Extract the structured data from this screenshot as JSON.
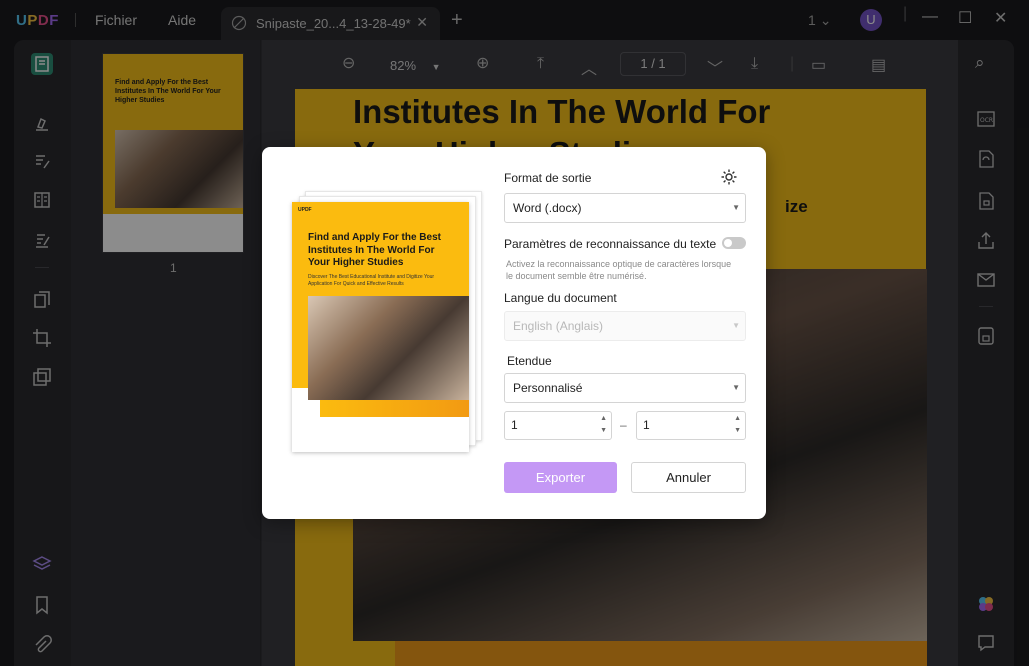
{
  "app": {
    "logo": "UPDF",
    "menu": [
      "Fichier",
      "Aide"
    ],
    "tab_title": "Snipaste_20...4_13-28-49*",
    "tab_count": "1",
    "avatar_letter": "U"
  },
  "toolbar": {
    "zoom": "82%",
    "page_current": "1",
    "page_total": "1"
  },
  "thumbnail": {
    "page_number": "1"
  },
  "document": {
    "heading_line1": "Institutes In The World For",
    "heading_line2": "Your Higher Studies",
    "fragment": "ize"
  },
  "preview": {
    "title": "Find and Apply For the Best Institutes In The World For Your Higher Studies",
    "subtitle": "Discover The Best Educational Institute and Digitize Your Application For Quick and Effective Results",
    "brand": "UPDF"
  },
  "dialog": {
    "output_format_label": "Format de sortie",
    "output_format_value": "Word (.docx)",
    "ocr_label": "Paramètres de reconnaissance du texte",
    "ocr_enabled": false,
    "ocr_hint": "Activez la reconnaissance optique de caractères lorsque le document semble être numérisé.",
    "language_label": "Langue du document",
    "language_value": "English (Anglais)",
    "range_label": "Etendue",
    "range_value": "Personnalisé",
    "range_from": "1",
    "range_to": "1",
    "range_separator": "–",
    "export_button": "Exporter",
    "cancel_button": "Annuler"
  },
  "colors": {
    "accent_purple": "#c498f5",
    "brand_green": "#2f8e76",
    "page_yellow": "#f7c21a"
  }
}
